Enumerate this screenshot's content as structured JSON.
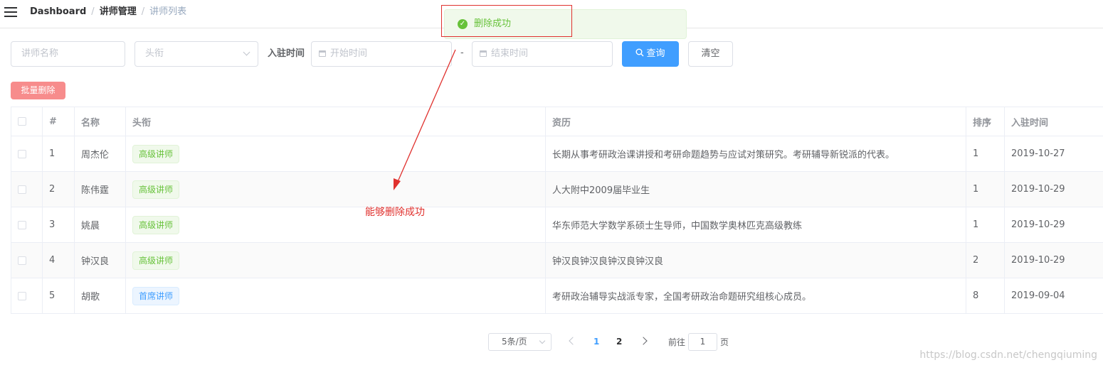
{
  "breadcrumb": {
    "items": [
      "Dashboard",
      "讲师管理"
    ],
    "current": "讲师列表"
  },
  "toast": {
    "message": "删除成功"
  },
  "search": {
    "name_placeholder": "讲师名称",
    "level_placeholder": "头衔",
    "time_label": "入驻时间",
    "start_placeholder": "开始时间",
    "range_separator": "-",
    "end_placeholder": "结束时间",
    "query_label": "查询",
    "clear_label": "清空"
  },
  "batch_delete_label": "批量删除",
  "table": {
    "columns": [
      "#",
      "名称",
      "头衔",
      "资历",
      "排序",
      "入驻时间"
    ],
    "rows": [
      {
        "index": "1",
        "name": "周杰伦",
        "level": "高级讲师",
        "intro": "长期从事考研政治课讲授和考研命题趋势与应试对策研究。考研辅导新锐派的代表。",
        "sort": "1",
        "time": "2019-10-27"
      },
      {
        "index": "2",
        "name": "陈伟霆",
        "level": "高级讲师",
        "intro": "人大附中2009届毕业生",
        "sort": "1",
        "time": "2019-10-29"
      },
      {
        "index": "3",
        "name": "姚晨",
        "level": "高级讲师",
        "intro": "华东师范大学数学系硕士生导师，中国数学奥林匹克高级教练",
        "sort": "1",
        "time": "2019-10-29"
      },
      {
        "index": "4",
        "name": "钟汉良",
        "level": "高级讲师",
        "intro": "钟汉良钟汉良钟汉良钟汉良",
        "sort": "2",
        "time": "2019-10-29"
      },
      {
        "index": "5",
        "name": "胡歌",
        "level": "首席讲师",
        "intro": "考研政治辅导实战派专家，全国考研政治命题研究组核心成员。",
        "sort": "8",
        "time": "2019-09-04"
      }
    ]
  },
  "annotation": "能够删除成功",
  "pagination": {
    "page_size": "5条/页",
    "pages": [
      "1",
      "2"
    ],
    "current_page": "1",
    "goto_prefix": "前往",
    "goto_value": "1",
    "goto_suffix": "页"
  },
  "watermark": "https://blog.csdn.net/chengqiuming",
  "colors": {
    "primary": "#409eff",
    "success": "#67c23a",
    "danger": "#f56c6c",
    "annotation": "#e0312e"
  }
}
